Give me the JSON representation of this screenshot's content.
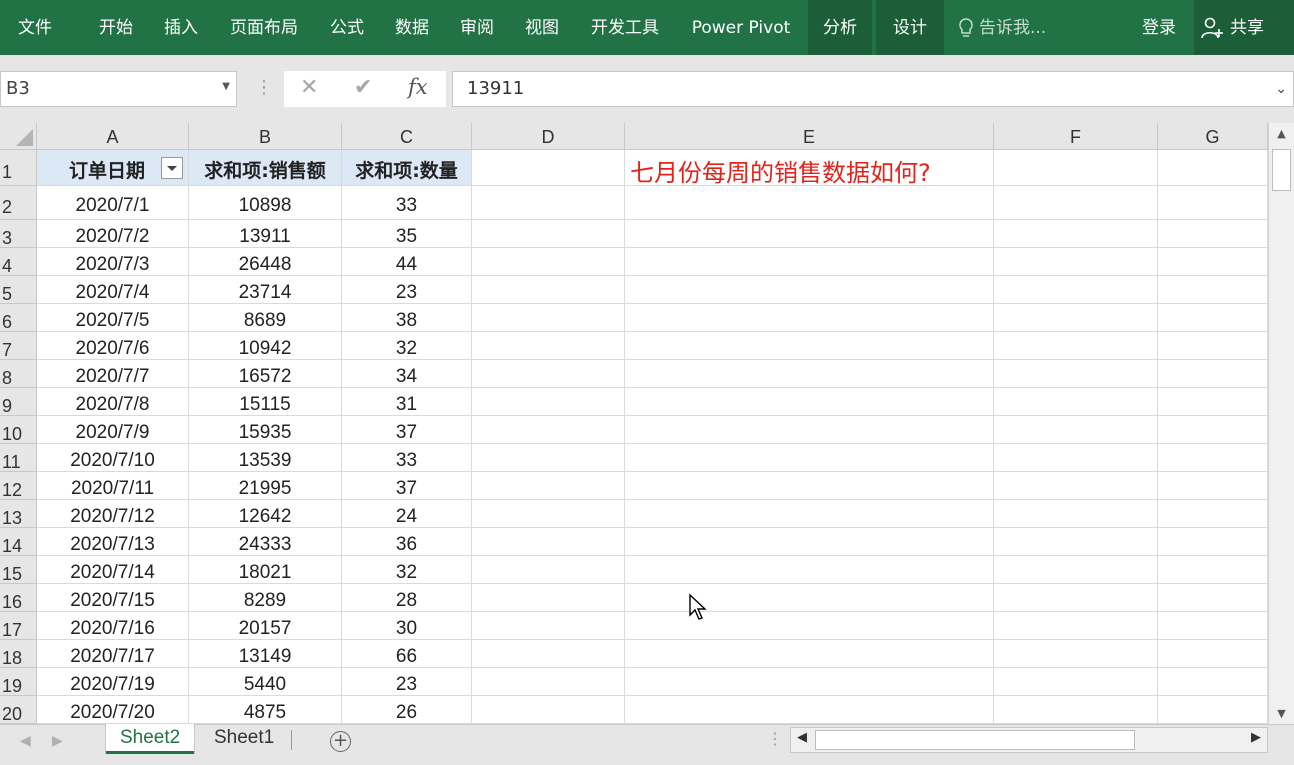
{
  "ribbon": {
    "tabs": [
      "文件",
      "开始",
      "插入",
      "页面布局",
      "公式",
      "数据",
      "审阅",
      "视图",
      "开发工具",
      "Power Pivot",
      "分析",
      "设计"
    ],
    "tell_me": "告诉我...",
    "login": "登录",
    "share": "共享",
    "colors": {
      "ribbon": "#217346",
      "active_tab": "#1b5e38"
    }
  },
  "formula_bar": {
    "name_box": "B3",
    "value": "13911",
    "cancel_icon": "✕",
    "enter_icon": "✔",
    "fx_label": "fx"
  },
  "grid": {
    "columns": [
      "A",
      "B",
      "C",
      "D",
      "E",
      "F",
      "G"
    ],
    "header_row": {
      "row": "1",
      "a": "订单日期",
      "b": "求和项:销售额",
      "c": "求和项:数量"
    },
    "rows": [
      {
        "row": "2",
        "date": "2020/7/1",
        "sales": "10898",
        "qty": "33"
      },
      {
        "row": "3",
        "date": "2020/7/2",
        "sales": "13911",
        "qty": "35"
      },
      {
        "row": "4",
        "date": "2020/7/3",
        "sales": "26448",
        "qty": "44"
      },
      {
        "row": "5",
        "date": "2020/7/4",
        "sales": "23714",
        "qty": "23"
      },
      {
        "row": "6",
        "date": "2020/7/5",
        "sales": "8689",
        "qty": "38"
      },
      {
        "row": "7",
        "date": "2020/7/6",
        "sales": "10942",
        "qty": "32"
      },
      {
        "row": "8",
        "date": "2020/7/7",
        "sales": "16572",
        "qty": "34"
      },
      {
        "row": "9",
        "date": "2020/7/8",
        "sales": "15115",
        "qty": "31"
      },
      {
        "row": "10",
        "date": "2020/7/9",
        "sales": "15935",
        "qty": "37"
      },
      {
        "row": "11",
        "date": "2020/7/10",
        "sales": "13539",
        "qty": "33"
      },
      {
        "row": "12",
        "date": "2020/7/11",
        "sales": "21995",
        "qty": "37"
      },
      {
        "row": "13",
        "date": "2020/7/12",
        "sales": "12642",
        "qty": "24"
      },
      {
        "row": "14",
        "date": "2020/7/13",
        "sales": "24333",
        "qty": "36"
      },
      {
        "row": "15",
        "date": "2020/7/14",
        "sales": "18021",
        "qty": "32"
      },
      {
        "row": "16",
        "date": "2020/7/15",
        "sales": "8289",
        "qty": "28"
      },
      {
        "row": "17",
        "date": "2020/7/16",
        "sales": "20157",
        "qty": "30"
      },
      {
        "row": "18",
        "date": "2020/7/17",
        "sales": "13149",
        "qty": "66"
      },
      {
        "row": "19",
        "date": "2020/7/19",
        "sales": "5440",
        "qty": "23"
      },
      {
        "row": "20",
        "date": "2020/7/20",
        "sales": "4875",
        "qty": "26"
      }
    ],
    "note": "七月份每周的销售数据如何?",
    "note_color": "#e2231a",
    "header_fill": "#dde8f6"
  },
  "sheets": {
    "tabs": [
      "Sheet2",
      "Sheet1"
    ],
    "active": "Sheet2"
  }
}
